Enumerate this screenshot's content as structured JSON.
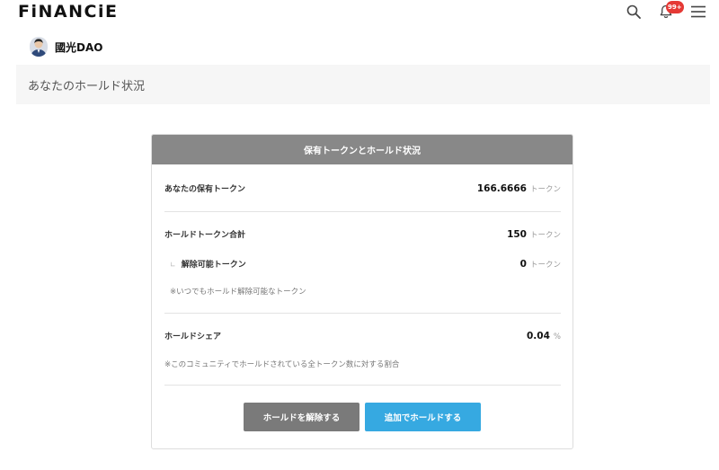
{
  "header": {
    "logo": "FiNANCiE",
    "notification_badge": "99+",
    "icons": [
      "search-icon",
      "bell-icon",
      "hamburger-menu-icon"
    ]
  },
  "community": {
    "name": "國光DAO"
  },
  "page": {
    "title": "あなたのホールド状況"
  },
  "card": {
    "header": "保有トークンとホールド状況",
    "owned": {
      "label": "あなたの保有トークン",
      "value": "166.6666",
      "unit": "トークン"
    },
    "hold_total": {
      "label": "ホールドトークン合計",
      "value": "150",
      "unit": "トークン"
    },
    "releasable": {
      "mark": "∟",
      "label": "解除可能トークン",
      "value": "0",
      "unit": "トークン"
    },
    "releasable_note": "※いつでもホールド解除可能なトークン",
    "hold_share": {
      "label": "ホールドシェア",
      "value": "0.04",
      "unit": "%"
    },
    "hold_share_note": "※このコミュニティでホールドされている全トークン数に対する割合",
    "buttons": {
      "release": "ホールドを解除する",
      "add": "追加でホールドする"
    }
  },
  "colors": {
    "header_bg": "#888888",
    "release_button": "#7a7a7a",
    "add_button": "#36a9e1",
    "badge": "#e53935"
  }
}
